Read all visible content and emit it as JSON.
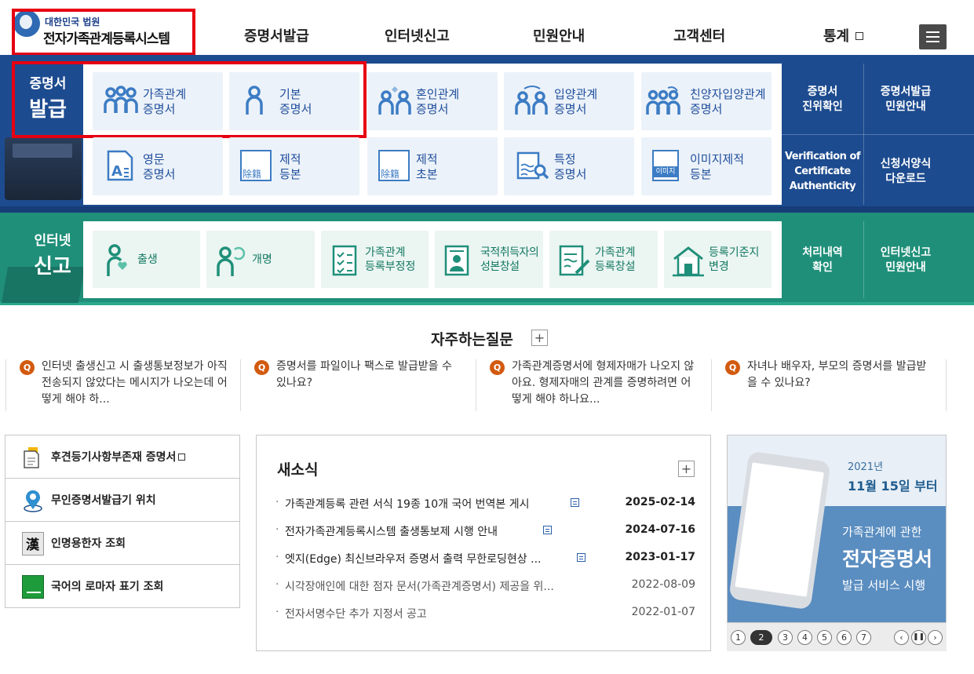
{
  "header": {
    "logo_sub": "대한민국 법원",
    "logo_main": "전자가족관계등록시스템",
    "nav": [
      "증명서발급",
      "인터넷신고",
      "민원안내",
      "고객센터",
      "통계"
    ],
    "menu_icon": "hamburger-icon"
  },
  "issue": {
    "title_line1": "증명서",
    "title_line2": "발급",
    "cards": [
      {
        "line1": "가족관계",
        "line2": "증명서",
        "icon": "family-icon"
      },
      {
        "line1": "기본",
        "line2": "증명서",
        "icon": "person-icon"
      },
      {
        "line1": "혼인관계",
        "line2": "증명서",
        "icon": "couple-heart-icon"
      },
      {
        "line1": "입양관계",
        "line2": "증명서",
        "icon": "adoption-icon"
      },
      {
        "line1": "친양자입양관계",
        "line2": "증명서",
        "icon": "family-adoption-icon"
      },
      {
        "line1": "영문",
        "line2": "증명서",
        "icon": "english-document-icon"
      },
      {
        "line1": "제적",
        "line2": "등본",
        "icon": "removed-register-icon",
        "badge": "除籍"
      },
      {
        "line1": "제적",
        "line2": "초본",
        "icon": "removed-extract-icon",
        "badge": "除籍"
      },
      {
        "line1": "특정",
        "line2": "증명서",
        "icon": "search-document-icon"
      },
      {
        "line1": "이미지제적",
        "line2": "등본",
        "icon": "image-register-icon",
        "badge": "이미지"
      }
    ],
    "side_links": [
      {
        "line1": "증명서",
        "line2": "진위확인"
      },
      {
        "line1": "증명서발급",
        "line2": "민원안내"
      },
      {
        "line1": "Verification of",
        "line2": "Certificate",
        "line3": "Authenticity"
      },
      {
        "line1": "신청서양식",
        "line2": "다운로드"
      }
    ]
  },
  "report": {
    "title_line1": "인터넷",
    "title_line2": "신고",
    "cards": [
      {
        "line1": "출생",
        "line2": "",
        "icon": "mother-baby-icon"
      },
      {
        "line1": "개명",
        "line2": "",
        "icon": "rename-person-icon"
      },
      {
        "line1": "가족관계",
        "line2": "등록부정정",
        "icon": "checklist-icon"
      },
      {
        "line1": "국적취득자의",
        "line2": "성본창설",
        "icon": "id-card-icon"
      },
      {
        "line1": "가족관계",
        "line2": "등록창설",
        "icon": "write-document-icon"
      },
      {
        "line1": "등록기준지",
        "line2": "변경",
        "icon": "house-icon"
      }
    ],
    "side_links": [
      {
        "line1": "처리내역",
        "line2": "확인"
      },
      {
        "line1": "인터넷신고",
        "line2": "민원안내"
      }
    ]
  },
  "faq": {
    "title": "자주하는질문",
    "items": [
      "인터넷 출생신고 시 출생통보정보가 아직 전송되지 않았다는 메시지가 나오는데 어떻게 해야 하...",
      "증명서를 파일이나 팩스로 발급받을 수 있나요?",
      "가족관계증명서에 형제자매가 나오지 않아요. 형제자매의 관계를 증명하려면 어떻게 해야 하나요...",
      "자녀나 배우자, 부모의 증명서를 발급받을 수 있나요?"
    ]
  },
  "quick": [
    {
      "label": "후견등기사항부존재 증명서",
      "icon": "document-icon",
      "external": true
    },
    {
      "label": "무인증명서발급기 위치",
      "icon": "location-pin-icon",
      "external": false
    },
    {
      "label": "인명용한자 조회",
      "icon": "hanja-book-icon",
      "glyph": "漢",
      "external": false
    },
    {
      "label": "국어의 로마자 표기 조회",
      "icon": "green-book-icon",
      "external": false
    }
  ],
  "news": {
    "title": "새소식",
    "items": [
      {
        "title": "가족관계등록 관련 서식 19종 10개 국어 번역본 게시",
        "date": "2025-02-14",
        "new": true
      },
      {
        "title": "전자가족관계등록시스템 출생통보제 시행 안내",
        "date": "2024-07-16",
        "new": true
      },
      {
        "title": "엣지(Edge) 최신브라우저 증명서 출력 무한로딩현상 ...",
        "date": "2023-01-17",
        "new": true
      },
      {
        "title": "시각장애인에 대한 점자 문서(가족관계증명서) 제공을 위...",
        "date": "2022-08-09",
        "new": false
      },
      {
        "title": "전자서명수단 추가 지정서 공고",
        "date": "2022-01-07",
        "new": false
      }
    ]
  },
  "banner": {
    "year": "2021년",
    "date": "11월 15일 부터",
    "line1": "가족관계에 관한",
    "line2": "전자증명서",
    "line3": "발급 서비스 시행",
    "pages": [
      "1",
      "2",
      "3",
      "4",
      "5",
      "6",
      "7"
    ],
    "current_page": "2"
  },
  "colors": {
    "issue_band": "#1d4b8f",
    "report_band": "#1f8f79",
    "highlight": "#e60012",
    "card_text": "#1e4d9c"
  }
}
